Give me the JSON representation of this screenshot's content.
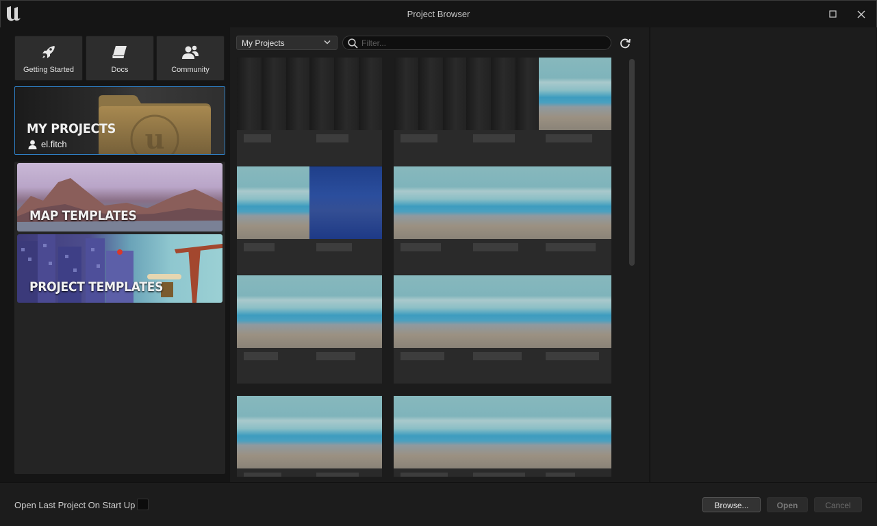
{
  "window": {
    "title": "Project Browser"
  },
  "sidebar": {
    "quick_links": [
      {
        "label": "Getting Started",
        "icon": "rocket-icon"
      },
      {
        "label": "Docs",
        "icon": "book-icon"
      },
      {
        "label": "Community",
        "icon": "people-icon"
      }
    ],
    "my_projects": {
      "title": "MY PROJECTS",
      "user": "el.fitch"
    },
    "templates": [
      {
        "label": "MAP TEMPLATES"
      },
      {
        "label": "PROJECT TEMPLATES"
      }
    ]
  },
  "toolbar": {
    "dropdown_value": "My Projects",
    "search_placeholder": "Filter...",
    "search_value": ""
  },
  "footer": {
    "startup_label": "Open Last Project On Start Up",
    "startup_checked": false,
    "browse_label": "Browse...",
    "open_label": "Open",
    "cancel_label": "Cancel"
  },
  "colors": {
    "accent_selected": "#2f80c6",
    "background": "#151515",
    "panel": "#1c1c1c"
  }
}
